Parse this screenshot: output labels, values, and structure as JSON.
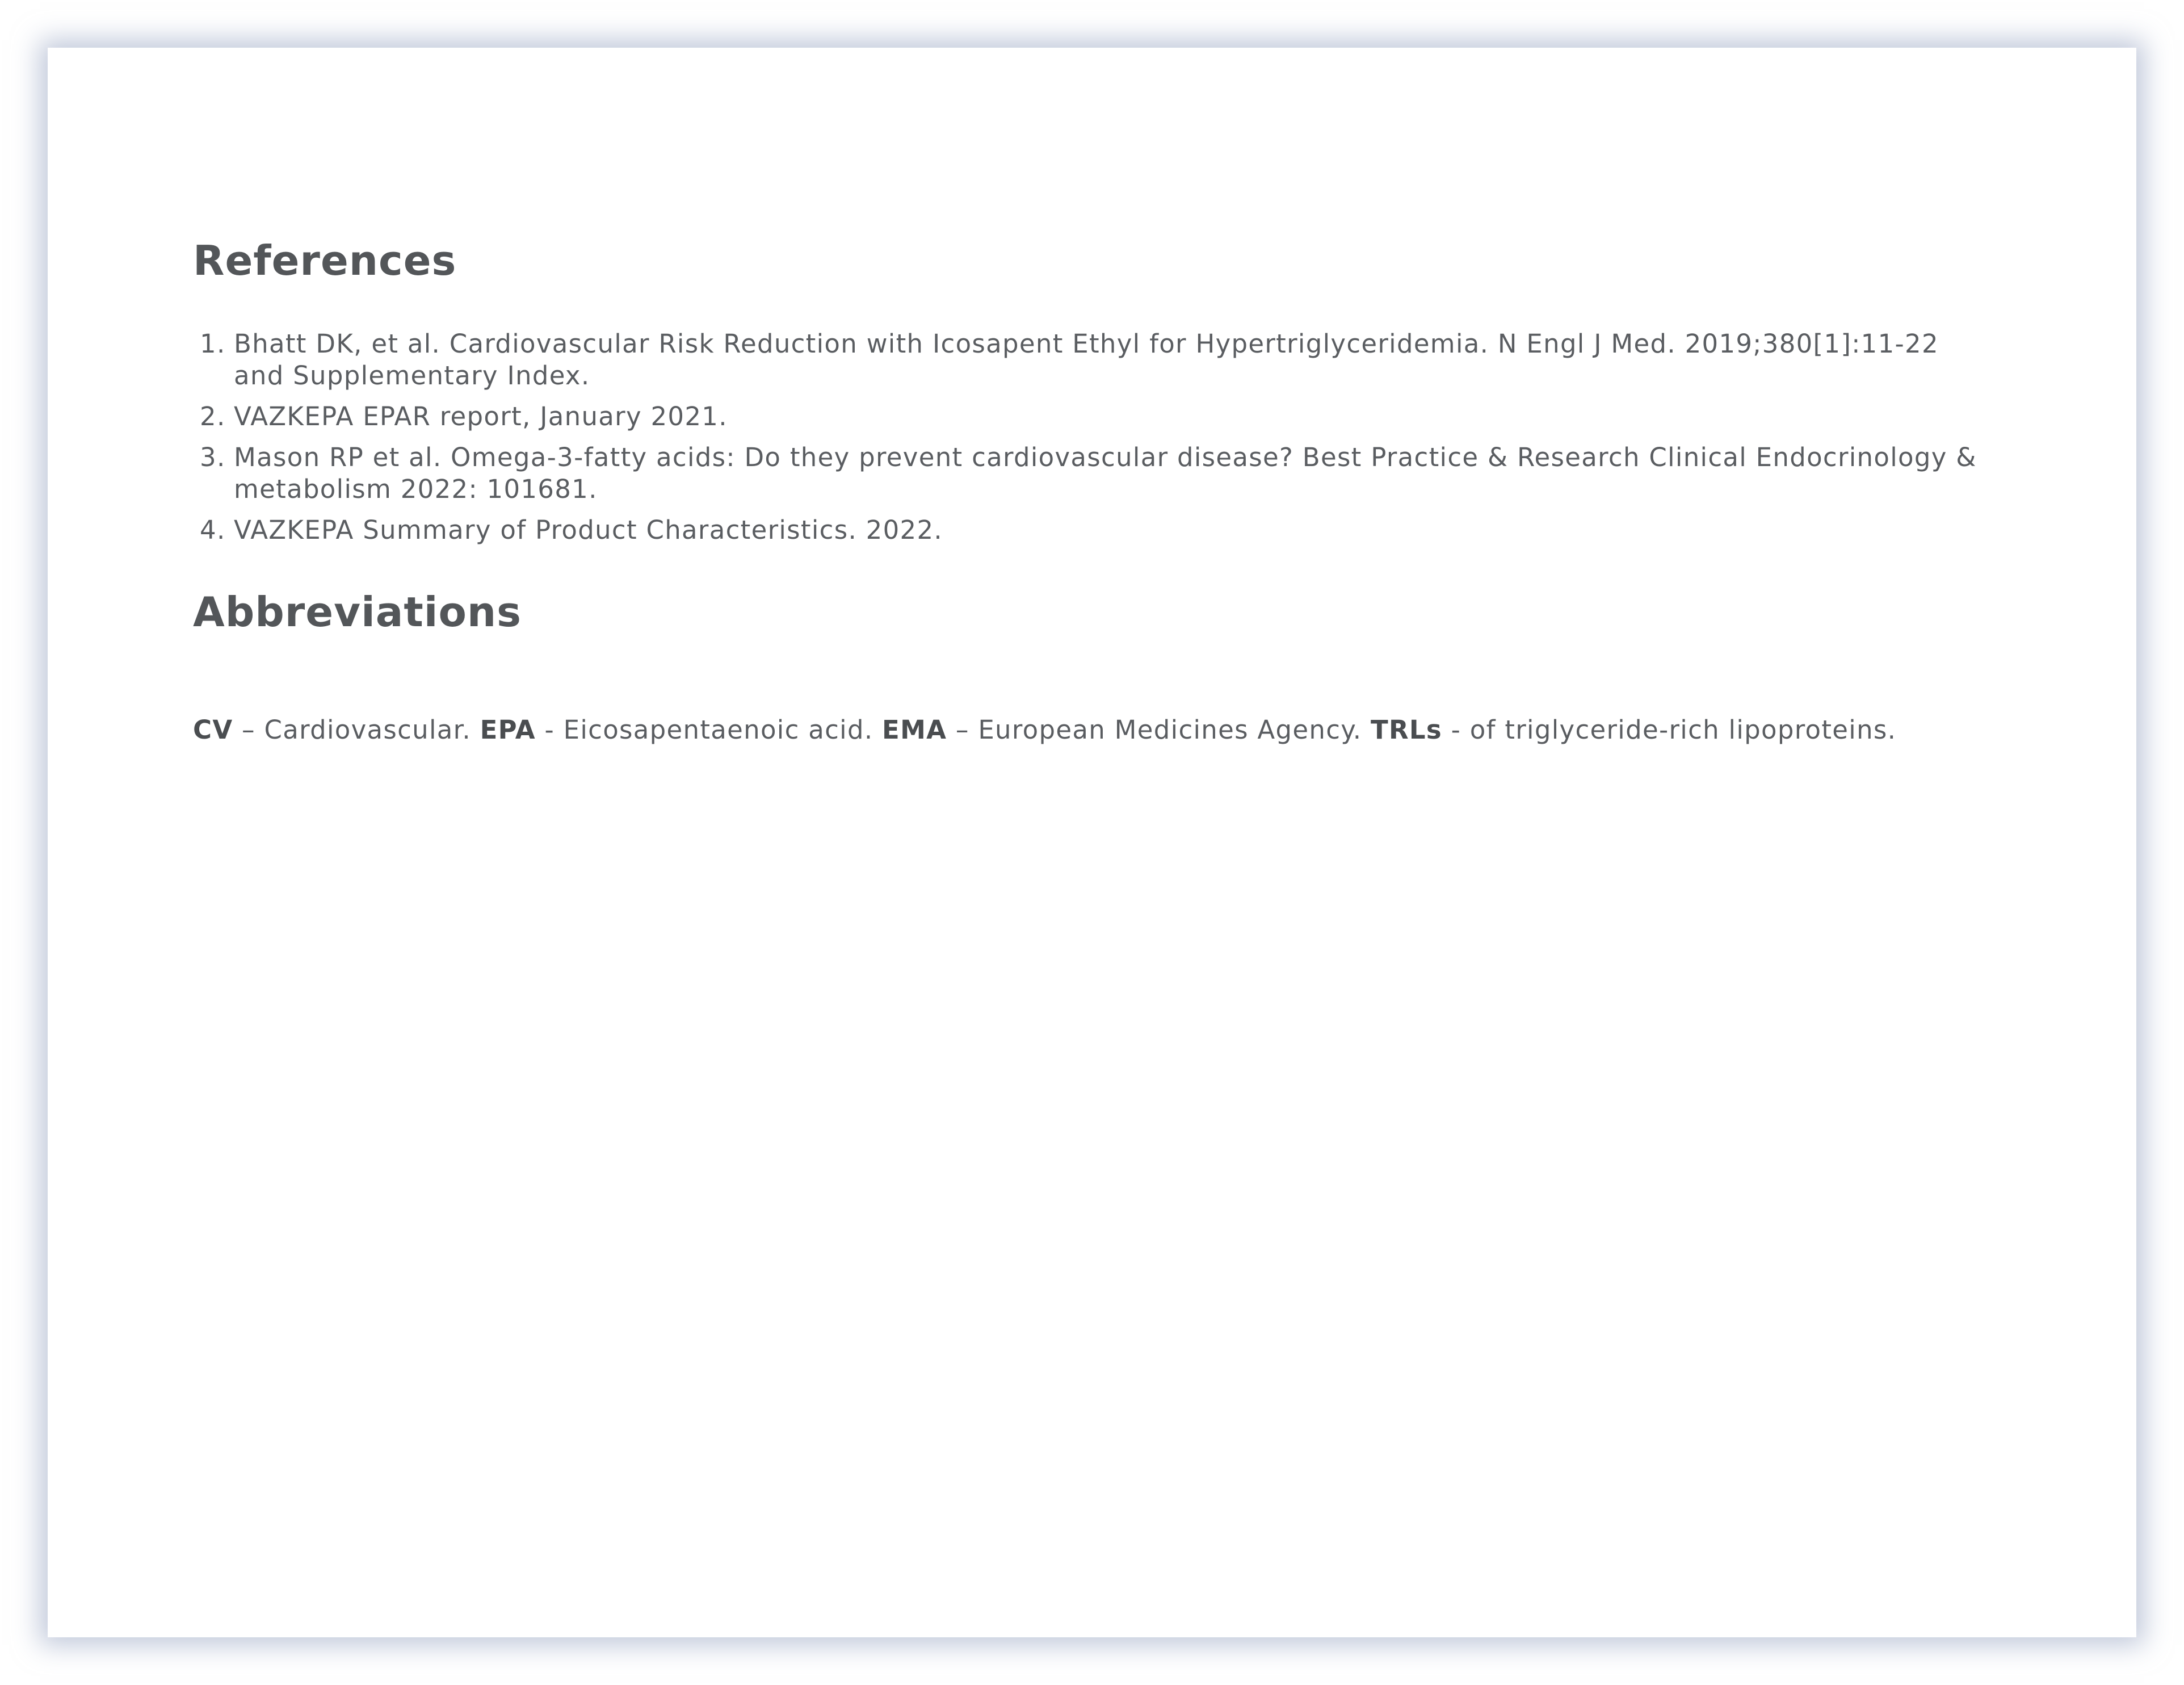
{
  "references": {
    "heading": "References",
    "items": [
      "Bhatt DK, et al. Cardiovascular Risk Reduction with Icosapent Ethyl for Hypertriglyceridemia. N Engl J Med. 2019;380[1]:11-22 and Supplementary Index.",
      "VAZKEPA EPAR report, January 2021.",
      "Mason RP et al. Omega-3-fatty acids: Do they prevent cardiovascular disease? Best Practice & Research Clinical Endocrinology & metabolism 2022: 101681.",
      "VAZKEPA Summary of Product Characteristics. 2022."
    ]
  },
  "abbreviations": {
    "heading": "Abbreviations",
    "items": [
      {
        "term": "CV",
        "sep": " – ",
        "definition": "Cardiovascular."
      },
      {
        "term": "EPA",
        "sep": " - ",
        "definition": "Eicosapentaenoic acid."
      },
      {
        "term": "EMA",
        "sep": " – ",
        "definition": "European Medicines Agency."
      },
      {
        "term": "TRLs",
        "sep": " - ",
        "definition": "of triglyceride-rich lipoproteins."
      }
    ]
  }
}
